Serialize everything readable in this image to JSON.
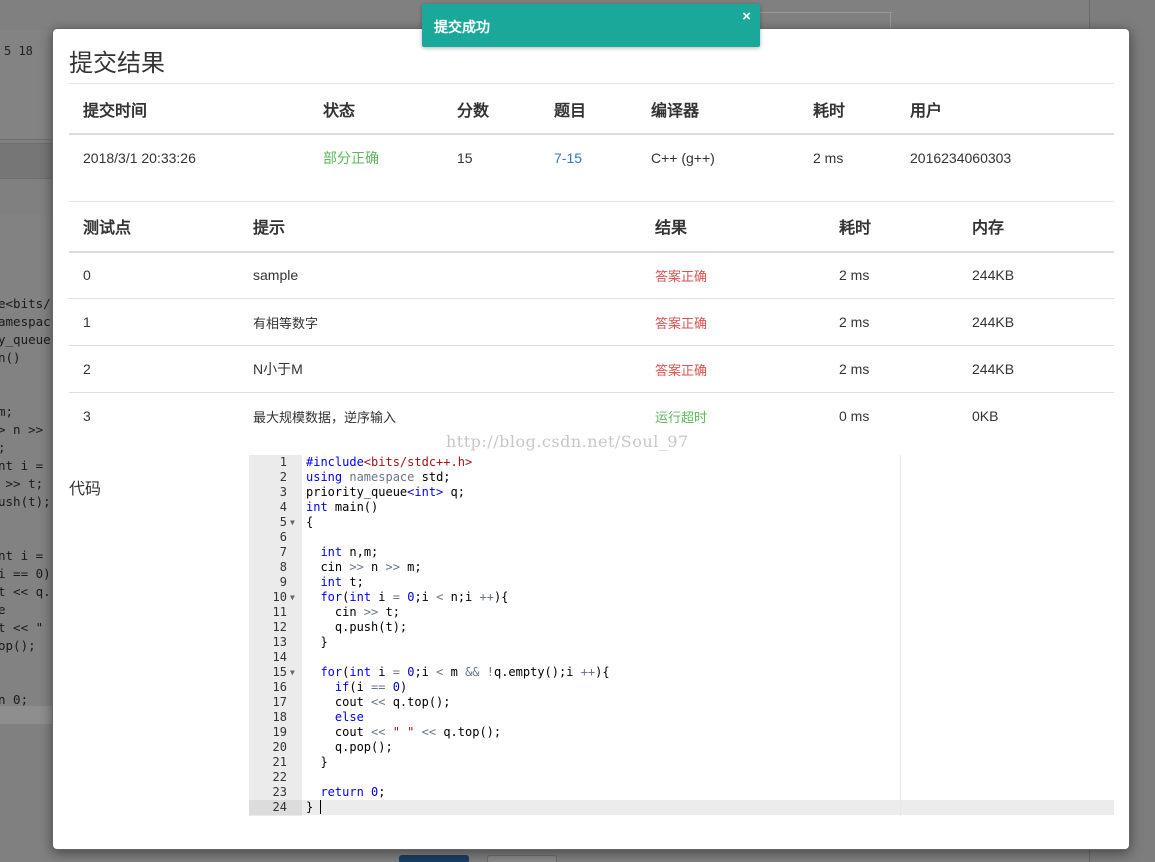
{
  "background": {
    "corner_number": "5 18",
    "code_fragments": [
      "e<bits/",
      "amespac",
      "y_queue",
      "n()",
      "",
      "",
      "m;",
      "> n >>",
      ";",
      "nt i =",
      " >> t;",
      "ush(t);",
      "",
      "",
      "nt i =",
      "i == 0)",
      "t << q.",
      "e",
      "t << \"",
      "op();",
      "",
      "",
      "n 0;"
    ]
  },
  "modal": {
    "title": "提交结果",
    "summary_headers": [
      "提交时间",
      "状态",
      "分数",
      "题目",
      "编译器",
      "耗时",
      "用户"
    ],
    "summary_row": {
      "time": "2018/3/1 20:33:26",
      "status": "部分正确",
      "score": "15",
      "problem": "7-15",
      "compiler": "C++ (g++)",
      "duration": "2 ms",
      "user": "2016234060303"
    },
    "case_headers": [
      "测试点",
      "提示",
      "结果",
      "耗时",
      "内存"
    ],
    "cases": [
      {
        "id": "0",
        "hint": "sample",
        "result": "答案正确",
        "time": "2 ms",
        "memory": "244KB"
      },
      {
        "id": "1",
        "hint": "有相等数字",
        "result": "答案正确",
        "time": "2 ms",
        "memory": "244KB"
      },
      {
        "id": "2",
        "hint": "N小于M",
        "result": "答案正确",
        "time": "2 ms",
        "memory": "244KB"
      },
      {
        "id": "3",
        "hint": "最大规模数据，逆序输入",
        "result": "运行超时",
        "time": "0 ms",
        "memory": "0KB"
      }
    ],
    "watermark": "http://blog.csdn.net/Soul_97",
    "code_label": "代码"
  },
  "toast": {
    "message": "提交成功",
    "close": "×"
  },
  "colors": {
    "toast": "#1aa89b",
    "partial": "#5cb85c",
    "accepted": "#d9534f",
    "timeout": "#5cb85c",
    "link": "#337ab7"
  }
}
